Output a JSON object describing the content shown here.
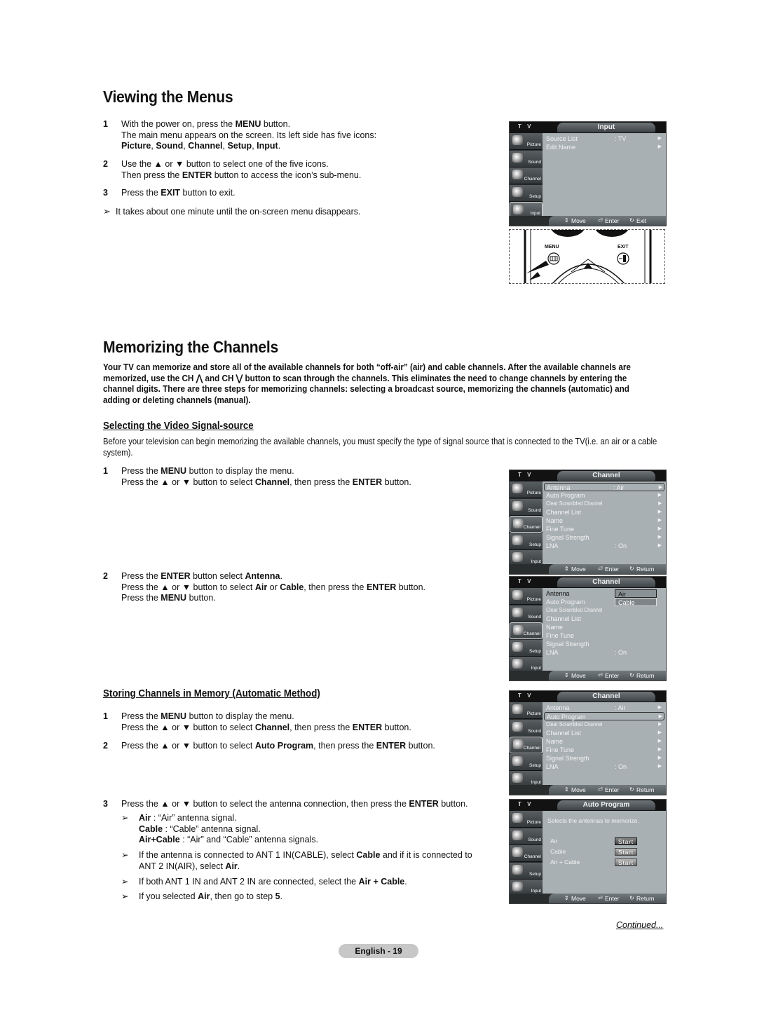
{
  "section1": {
    "title": "Viewing the Menus",
    "steps": [
      {
        "num": "1",
        "lines": [
          [
            {
              "t": "With the power on, press the "
            },
            {
              "t": "MENU",
              "b": true
            },
            {
              "t": " button."
            }
          ],
          [
            {
              "t": "The main menu appears on the screen. Its left side has five icons:"
            }
          ],
          [
            {
              "t": "Picture",
              "b": true
            },
            {
              "t": ", "
            },
            {
              "t": "Sound",
              "b": true
            },
            {
              "t": ", "
            },
            {
              "t": "Channel",
              "b": true
            },
            {
              "t": ", "
            },
            {
              "t": "Setup",
              "b": true
            },
            {
              "t": ", "
            },
            {
              "t": "Input",
              "b": true
            },
            {
              "t": "."
            }
          ]
        ]
      },
      {
        "num": "2",
        "lines": [
          [
            {
              "t": "Use the ▲ or ▼ button to select one of the five icons."
            }
          ],
          [
            {
              "t": "Then press the "
            },
            {
              "t": "ENTER",
              "b": true
            },
            {
              "t": " button to access the icon’s sub-menu."
            }
          ]
        ]
      },
      {
        "num": "3",
        "lines": [
          [
            {
              "t": "Press the "
            },
            {
              "t": "EXIT",
              "b": true
            },
            {
              "t": " button to exit."
            }
          ]
        ]
      }
    ],
    "note": "It takes about one minute until the on-screen menu disappears."
  },
  "section2": {
    "title": "Memorizing the Channels",
    "intro": "Your TV can memorize and store all of the available channels for both “off-air” (air) and cable channels. After the available channels are memorized, use the CH ⋀ and CH ⋁ button to scan through the channels. This eliminates the need to change channels by entering the channel digits. There are three steps for memorizing channels: selecting a broadcast source, memorizing the channels (automatic) and adding or deleting channels (manual).",
    "sub1": {
      "title": "Selecting the Video Signal-source",
      "para": "Before your television can begin memorizing the available channels, you must specify the type of signal source that is connected to the TV(i.e. an air or a cable system).",
      "steps": [
        {
          "num": "1",
          "lines": [
            [
              {
                "t": "Press the "
              },
              {
                "t": "MENU",
                "b": true
              },
              {
                "t": " button to display the menu."
              }
            ],
            [
              {
                "t": "Press the ▲ or ▼ button to select "
              },
              {
                "t": "Channel",
                "b": true
              },
              {
                "t": ", then press the "
              },
              {
                "t": "ENTER",
                "b": true
              },
              {
                "t": " button."
              }
            ]
          ]
        },
        {
          "num": "2",
          "lines": [
            [
              {
                "t": "Press the "
              },
              {
                "t": "ENTER",
                "b": true
              },
              {
                "t": " button select "
              },
              {
                "t": "Antenna",
                "b": true
              },
              {
                "t": "."
              }
            ],
            [
              {
                "t": "Press the ▲ or ▼ button to select "
              },
              {
                "t": "Air",
                "b": true
              },
              {
                "t": " or "
              },
              {
                "t": "Cable",
                "b": true
              },
              {
                "t": ", then press the "
              },
              {
                "t": "ENTER",
                "b": true
              },
              {
                "t": " button."
              }
            ],
            [
              {
                "t": "Press the "
              },
              {
                "t": "MENU",
                "b": true
              },
              {
                "t": " button."
              }
            ]
          ]
        }
      ]
    },
    "sub2": {
      "title": "Storing Channels in Memory (Automatic Method)",
      "steps": [
        {
          "num": "1",
          "lines": [
            [
              {
                "t": "Press the "
              },
              {
                "t": "MENU",
                "b": true
              },
              {
                "t": " button to display the menu."
              }
            ],
            [
              {
                "t": "Press the ▲ or ▼ button to select "
              },
              {
                "t": "Channel",
                "b": true
              },
              {
                "t": ", then press the "
              },
              {
                "t": "ENTER",
                "b": true
              },
              {
                "t": " button."
              }
            ]
          ]
        },
        {
          "num": "2",
          "lines": [
            [
              {
                "t": "Press the ▲ or ▼ button to select "
              },
              {
                "t": "Auto Program",
                "b": true
              },
              {
                "t": ", then press the "
              },
              {
                "t": "ENTER",
                "b": true
              },
              {
                "t": " button."
              }
            ]
          ]
        },
        {
          "num": "3",
          "lines": [
            [
              {
                "t": "Press the ▲ or ▼ button to select the antenna connection, then press the "
              },
              {
                "t": "ENTER",
                "b": true
              },
              {
                "t": " button."
              }
            ]
          ]
        }
      ],
      "notes": [
        [
          [
            {
              "t": "Air",
              "b": true
            },
            {
              "t": " : “Air” antenna signal."
            }
          ],
          [
            {
              "t": "Cable",
              "b": true
            },
            {
              "t": " : “Cable” antenna signal."
            }
          ],
          [
            {
              "t": "Air+Cable",
              "b": true
            },
            {
              "t": " : “Air” and “Cable” antenna signals."
            }
          ]
        ],
        [
          [
            {
              "t": "If the antenna is connected to ANT 1 IN(CABLE), select "
            },
            {
              "t": "Cable",
              "b": true
            },
            {
              "t": " and if it is connected to"
            }
          ],
          [
            {
              "t": "ANT 2 IN(AIR), select "
            },
            {
              "t": "Air",
              "b": true
            },
            {
              "t": "."
            }
          ]
        ],
        [
          [
            {
              "t": "If both ANT 1 IN and ANT 2 IN are connected, select the "
            },
            {
              "t": "Air + Cable",
              "b": true
            },
            {
              "t": "."
            }
          ]
        ],
        [
          [
            {
              "t": "If you selected "
            },
            {
              "t": "Air",
              "b": true
            },
            {
              "t": ", then go to step "
            },
            {
              "t": "5",
              "b": true
            },
            {
              "t": "."
            }
          ]
        ]
      ]
    }
  },
  "tv_common": {
    "brand": "T V",
    "side_items": [
      "Picture",
      "Sound",
      "Channel",
      "Setup",
      "Input"
    ],
    "foot_move": "Move",
    "foot_enter": "Enter",
    "foot_exit": "Exit",
    "foot_return": "Return"
  },
  "tv_menus": {
    "input": {
      "title": "Input",
      "selected_side": "Input",
      "rows": [
        {
          "label": "Source List",
          "value": ": TV"
        },
        {
          "label": "Edit Name",
          "value": ""
        }
      ]
    },
    "channel_rows": [
      {
        "label": "Antenna",
        "value": ": Air"
      },
      {
        "label": "Auto Program",
        "value": ""
      },
      {
        "label": "Clear Scrambled Channel",
        "value": "",
        "small": true
      },
      {
        "label": "Channel List",
        "value": ""
      },
      {
        "label": "Name",
        "value": ""
      },
      {
        "label": "Fine Tune",
        "value": ""
      },
      {
        "label": "Signal Strength",
        "value": ""
      },
      {
        "label": "LNA",
        "value": ": On"
      }
    ],
    "channel_title": "Channel",
    "antenna_options": [
      "Air",
      "Cable"
    ],
    "auto_program": {
      "title": "Auto Program",
      "desc": "Selects the antennas to memorize.",
      "options": [
        "Air",
        "Cable",
        "Air + Cable"
      ],
      "button_label": "Start"
    }
  },
  "remote": {
    "menu_label": "MENU",
    "exit_label": "EXIT"
  },
  "footer": {
    "continued": "Continued...",
    "page": "English - 19"
  }
}
